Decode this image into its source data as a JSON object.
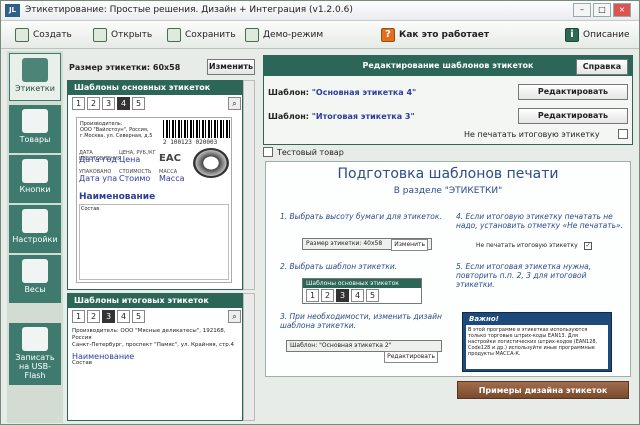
{
  "window": {
    "title": "Этикетирование: Простые решения. Дизайн + Интеграция (v1.2.0.6)",
    "icon": "JL"
  },
  "toolbar": {
    "create": "Создать",
    "open": "Открыть",
    "save": "Сохранить",
    "demo": "Демо-режим",
    "how": "Как это работает",
    "desc": "Описание"
  },
  "nav": {
    "labels": "Этикетки",
    "goods": "Товары",
    "buttons": "Кнопки",
    "settings": "Настройки",
    "scales": "Весы",
    "usb": "Записать на USB-Flash"
  },
  "size": {
    "label": "Размер этикетки: 60x58",
    "change": "Изменить"
  },
  "main_tpl": {
    "header": "Шаблоны основных этикеток",
    "tabs": [
      "1",
      "2",
      "3",
      "4",
      "5"
    ],
    "selected": 3
  },
  "label": {
    "producer": "Производитель:",
    "producer_line": "ООО \"Вайлстоун\", Россия,",
    "address": "г.Москва, ул. Северная, д.5",
    "barcode": "2 100123 020003",
    "c1_top": "ДАТА ИЗГОТОВЛЕНИЯ",
    "c1": "Дата год",
    "c2_top": "ЦЕНА, РУБ./КГ",
    "c2": "Цена",
    "c3": "EAC",
    "c4_top": "УПАКОВАНО",
    "c4": "Дата упа",
    "c5_top": "СТОИМОСТЬ",
    "c5": "Стоимо",
    "c6_top": "МАССА",
    "c6": "Масса",
    "name": "Наименование",
    "composition": "Состав"
  },
  "total_tpl": {
    "header": "Шаблоны итоговых этикеток",
    "tabs": [
      "1",
      "2",
      "3",
      "4",
      "5"
    ],
    "selected": 2,
    "line1": "Производитель: ООО \"Мясные деликатесы\", 192168, Россия",
    "line2": "Санкт-Петербург, проспект \"Памяс\", ул. Крайняя, стр.4",
    "name": "Наименование",
    "composition": "Состав"
  },
  "edit": {
    "header": "Редактирование шаблонов этикеток",
    "help": "Справка",
    "t1_label": "Шаблон:",
    "t1_value": "\"Основная этикетка 4\"",
    "t2_value": "\"Итоговая этикетка 3\"",
    "edit_btn": "Редактировать",
    "no_print": "Не печатать итоговую этикетку",
    "test": "Тестовый товар"
  },
  "card": {
    "title": "Подготовка шаблонов печати",
    "subtitle": "В разделе \"ЭТИКЕТКИ\"",
    "s1": "1. Выбрать высоту бумаги для этикеток.",
    "s1_mini": "Размер этикетки: 40x58",
    "s1_btn": "Изменить",
    "s2": "2. Выбрать шаблон этикетки.",
    "s2_hdr": "Шаблоны основных этикеток",
    "s3": "3. При необходимости, изменить дизайн шаблона этикетки.",
    "s3_mini": "Шаблон: \"Основная этикетка 2\"",
    "s3_btn": "Редактировать",
    "s4": "4. Если итоговую этикетку печатать не надо, установить отметку «Не печатать».",
    "s4_mini": "Не печатать итоговую этикетку",
    "s5": "5. Если итоговая этикетка нужна, повторить п.п. 2, 3 для итоговой этикетки.",
    "note_title": "Важно!",
    "note": "В этой программе в этикетках используются только торговые штрих-коды EAN13. Для настройки логистических штрих-кодов (EAN128, Code128 и др.) используйте иные программные продукты МАССА-К."
  },
  "examples": "Примеры дизайна этикеток",
  "colors": {
    "accent": "#2c6657",
    "nav": "#3e7b6e",
    "example_btn": "#8a5a3c"
  }
}
